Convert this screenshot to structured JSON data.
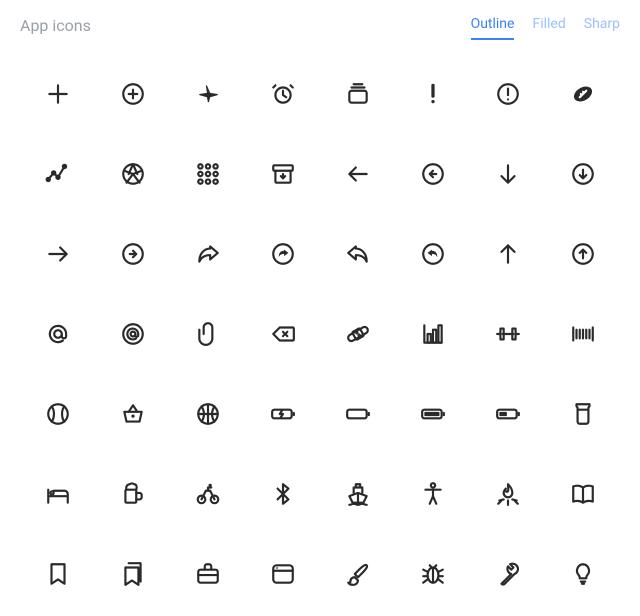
{
  "header": {
    "title": "App icons",
    "tabs": [
      {
        "label": "Outline",
        "active": true
      },
      {
        "label": "Filled",
        "active": false
      },
      {
        "label": "Sharp",
        "active": false
      }
    ]
  },
  "icons": [
    {
      "name": "add"
    },
    {
      "name": "add-circle"
    },
    {
      "name": "airplane"
    },
    {
      "name": "alarm"
    },
    {
      "name": "albums"
    },
    {
      "name": "alert"
    },
    {
      "name": "alert-circle"
    },
    {
      "name": "american-football"
    },
    {
      "name": "analytics"
    },
    {
      "name": "aperture"
    },
    {
      "name": "apps"
    },
    {
      "name": "archive"
    },
    {
      "name": "arrow-back"
    },
    {
      "name": "arrow-back-circle"
    },
    {
      "name": "arrow-down"
    },
    {
      "name": "arrow-down-circle"
    },
    {
      "name": "arrow-forward"
    },
    {
      "name": "arrow-forward-circle"
    },
    {
      "name": "arrow-redo"
    },
    {
      "name": "arrow-redo-circle"
    },
    {
      "name": "arrow-undo"
    },
    {
      "name": "arrow-undo-circle"
    },
    {
      "name": "arrow-up"
    },
    {
      "name": "arrow-up-circle"
    },
    {
      "name": "at"
    },
    {
      "name": "at-circle"
    },
    {
      "name": "attach"
    },
    {
      "name": "backspace"
    },
    {
      "name": "bandage"
    },
    {
      "name": "bar-chart"
    },
    {
      "name": "barbell"
    },
    {
      "name": "barcode"
    },
    {
      "name": "baseball"
    },
    {
      "name": "basket"
    },
    {
      "name": "basketball"
    },
    {
      "name": "battery-charging"
    },
    {
      "name": "battery-dead"
    },
    {
      "name": "battery-full"
    },
    {
      "name": "battery-half"
    },
    {
      "name": "beaker"
    },
    {
      "name": "bed"
    },
    {
      "name": "beer"
    },
    {
      "name": "bicycle"
    },
    {
      "name": "bluetooth"
    },
    {
      "name": "boat"
    },
    {
      "name": "body"
    },
    {
      "name": "bonfire"
    },
    {
      "name": "book"
    },
    {
      "name": "bookmark"
    },
    {
      "name": "bookmarks"
    },
    {
      "name": "briefcase"
    },
    {
      "name": "browser"
    },
    {
      "name": "brush"
    },
    {
      "name": "bug"
    },
    {
      "name": "build"
    },
    {
      "name": "bulb"
    }
  ]
}
